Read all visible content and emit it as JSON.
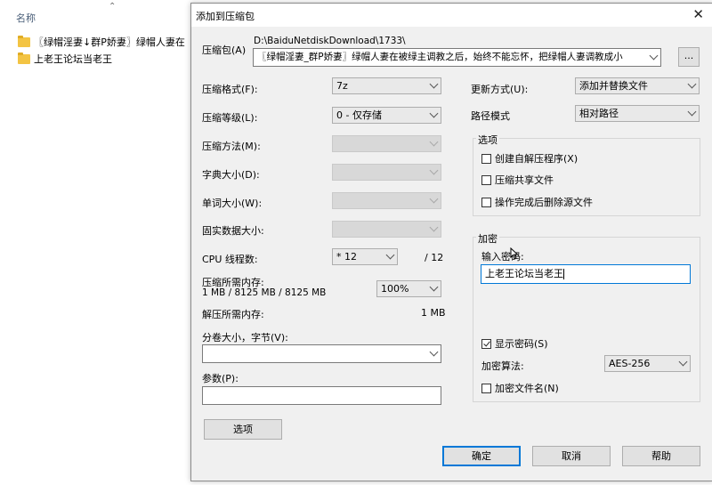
{
  "explorer": {
    "column_header": "名称",
    "sort_icon": "chevron-up-icon",
    "rows": [
      {
        "name": "〖绿帽淫妻↓群P娇妻〗绿帽人妻在"
      },
      {
        "name": "上老王论坛当老王"
      }
    ]
  },
  "dialog": {
    "title": "添加到压缩包",
    "archive": {
      "label": "压缩包(A)",
      "path": "D:\\BaiduNetdiskDownload\\1733\\",
      "name": "〖绿帽淫妻_群P娇妻〗绿帽人妻在被绿主调教之后，始终不能忘怀，把绿帽人妻调教成小",
      "browse_label": "..."
    },
    "left": {
      "format": {
        "label": "压缩格式(F):",
        "value": "7z"
      },
      "level": {
        "label": "压缩等级(L):",
        "value": "0 - 仅存储"
      },
      "method": {
        "label": "压缩方法(M):",
        "value": ""
      },
      "dict": {
        "label": "字典大小(D):",
        "value": ""
      },
      "word": {
        "label": "单词大小(W):",
        "value": ""
      },
      "solid": {
        "label": "固实数据大小:",
        "value": ""
      },
      "cpu": {
        "label": "CPU 线程数:",
        "value": "* 12",
        "total": "/ 12"
      },
      "mem_compress": {
        "label": "压缩所需内存:",
        "value": "1 MB / 8125 MB / 8125 MB",
        "percent": "100%"
      },
      "mem_decompress": {
        "label": "解压所需内存:",
        "value": "1 MB"
      },
      "volume": {
        "label": "分卷大小，字节(V):",
        "value": ""
      },
      "params": {
        "label": "参数(P):",
        "value": ""
      },
      "options_button": "选项"
    },
    "right": {
      "update": {
        "label": "更新方式(U):",
        "value": "添加并替换文件"
      },
      "pathmode": {
        "label": "路径模式",
        "value": "相对路径"
      },
      "options_group": "选项",
      "options": [
        {
          "label": "创建自解压程序(X)",
          "checked": false
        },
        {
          "label": "压缩共享文件",
          "checked": false
        },
        {
          "label": "操作完成后删除源文件",
          "checked": false
        }
      ],
      "encrypt_group": "加密",
      "password_label": "输入密码:",
      "password_value": "上老王论坛当老王",
      "show_password": {
        "label": "显示密码(S)",
        "checked": true
      },
      "algo": {
        "label": "加密算法:",
        "value": "AES-256"
      },
      "encrypt_names": {
        "label": "加密文件名(N)",
        "checked": false
      }
    },
    "buttons": {
      "ok": "确定",
      "cancel": "取消",
      "help": "帮助"
    }
  },
  "colors": {
    "accent": "#0078d7",
    "dialog_bg": "#f0f0f0",
    "folder": "#f3c443"
  }
}
